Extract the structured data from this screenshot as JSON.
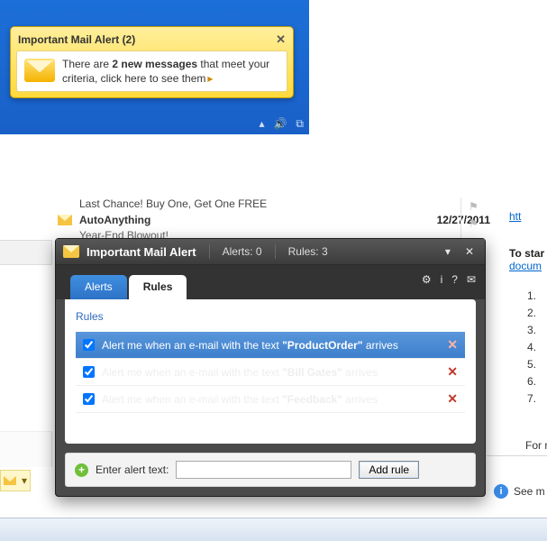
{
  "toast": {
    "title": "Important Mail Alert (2)",
    "line1_a": "There are ",
    "line1_b": "2 new messages",
    "line1_c": " that meet your",
    "line2_a": "criteria, click here to see them",
    "arrow": "▸"
  },
  "mail": {
    "subject_preview": "Last Chance! Buy One, Get One FREE",
    "sender": "AutoAnything",
    "date": "12/27/2011",
    "snippet": "Year-End Blowout!"
  },
  "side": {
    "http": "htt",
    "to_start": "To star",
    "docum": "docum",
    "items": {
      "n1": "1.",
      "n2": "2.",
      "n3": "3.",
      "n4": "4.",
      "n5": "5.",
      "n6": "6.",
      "n7": "7."
    },
    "for_more": "For mo",
    "see_more": "See m"
  },
  "dialog": {
    "title": "Important Mail Alert",
    "alerts_label": "Alerts: 0",
    "rules_label": "Rules: 3",
    "tabs": {
      "alerts": "Alerts",
      "rules": "Rules"
    },
    "section_heading": "Rules",
    "rules": [
      {
        "pre": "Alert me when an e-mail with the text ",
        "key": "\"ProductOrder\"",
        "post": " arrives"
      },
      {
        "pre": "Alert me when an e-mail with the text ",
        "key": "\"Bill Gates\"",
        "post": " arrives"
      },
      {
        "pre": "Alert me when an e-mail with the text ",
        "key": "\"Feedback\"",
        "post": " arrives"
      }
    ],
    "add_label": "Enter alert text:",
    "add_button": "Add rule"
  }
}
